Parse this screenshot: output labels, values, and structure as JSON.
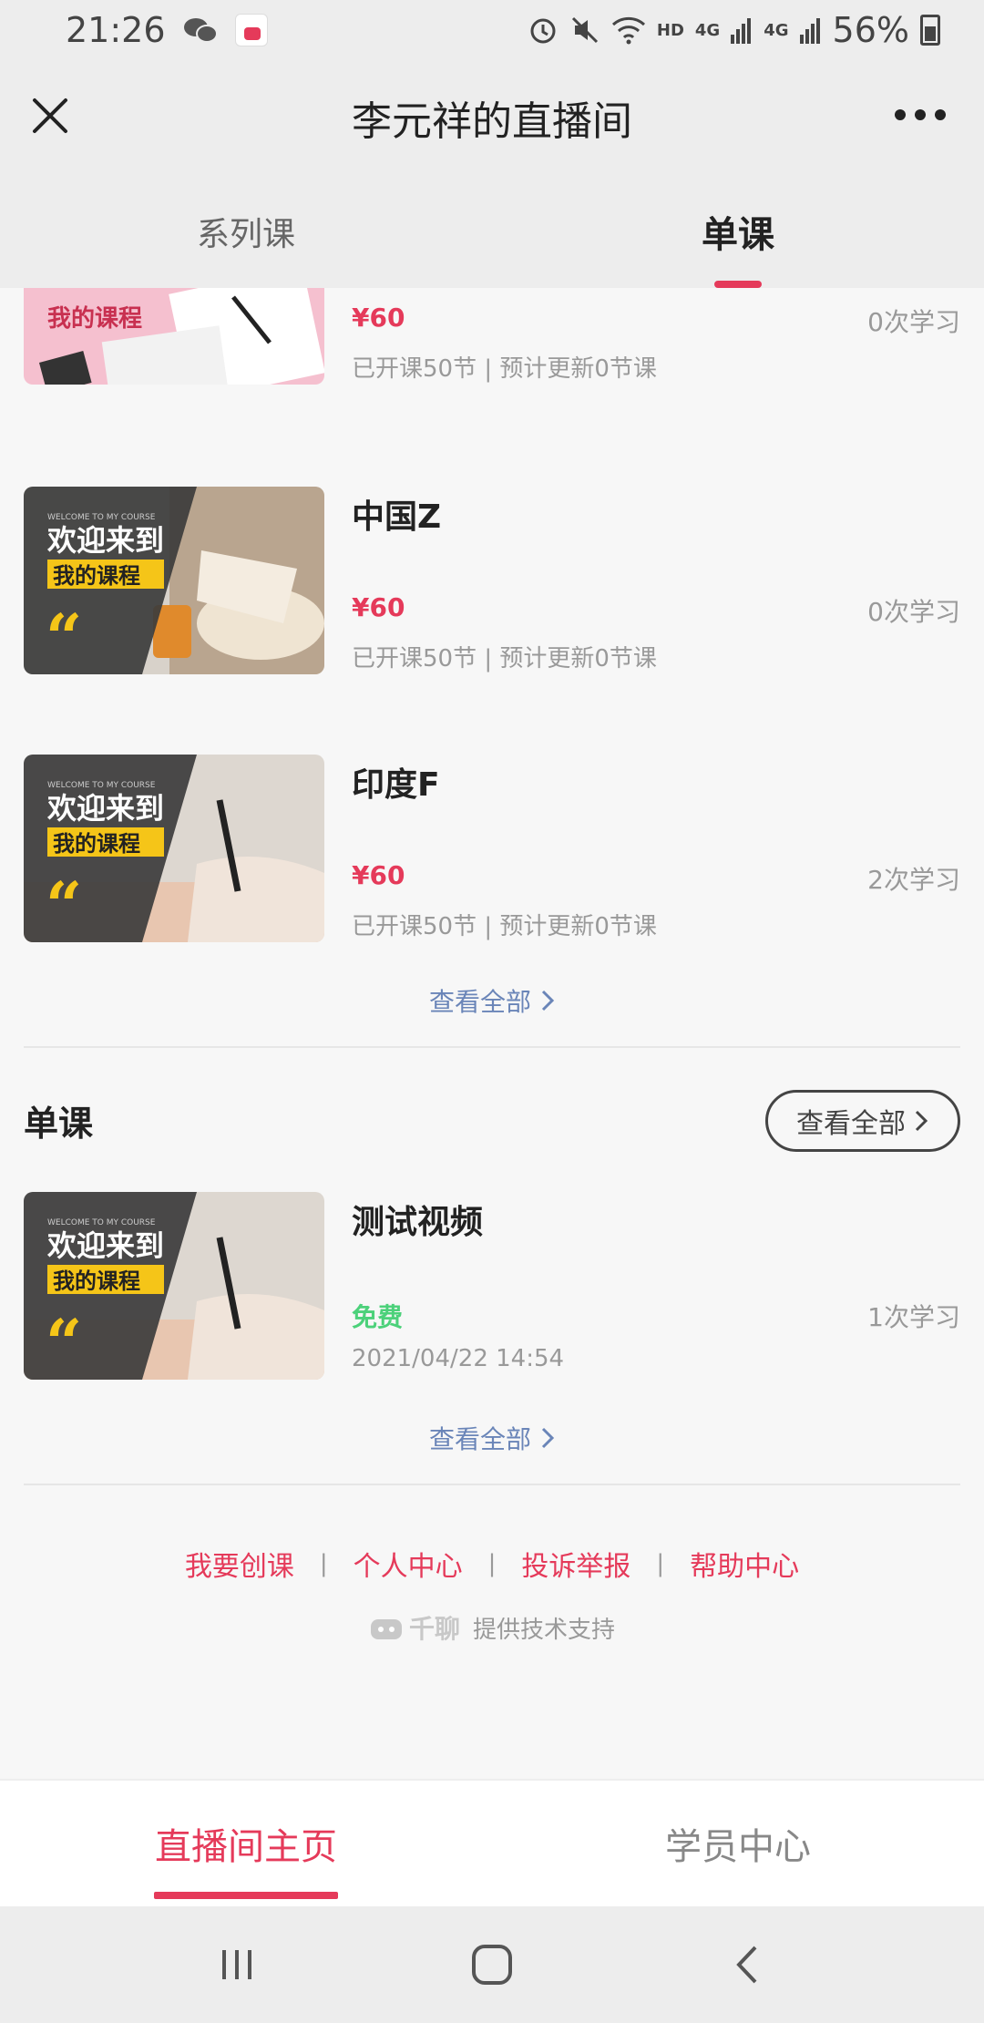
{
  "status_bar": {
    "time": "21:26",
    "icons": [
      "wechat-icon",
      "app-badge-icon",
      "alarm-icon",
      "mute-icon",
      "wifi-icon",
      "signal-icon",
      "battery-icon"
    ],
    "hd": "HD",
    "net1": "4G",
    "net2": "4G",
    "battery": "56%"
  },
  "header": {
    "title": "李元祥的直播间"
  },
  "tabs": [
    {
      "label": "系列课",
      "active": false
    },
    {
      "label": "单课",
      "active": true
    }
  ],
  "series_courses": [
    {
      "title": "",
      "price": "¥60",
      "count": "0次学习",
      "meta": "已开课50节 | 预计更新0节课",
      "thumb": "pink"
    },
    {
      "title": "中国Z",
      "price": "¥60",
      "count": "0次学习",
      "meta": "已开课50节 | 预计更新0节课",
      "thumb": "book"
    },
    {
      "title": "印度F",
      "price": "¥60",
      "count": "2次学习",
      "meta": "已开课50节 | 预计更新0节课",
      "thumb": "pen"
    }
  ],
  "view_all_1": "查看全部",
  "single_section": {
    "title": "单课",
    "button": "查看全部"
  },
  "single_courses": [
    {
      "title": "测试视频",
      "price": "免费",
      "count": "1次学习",
      "meta": "2021/04/22 14:54",
      "thumb": "pen"
    }
  ],
  "view_all_2": "查看全部",
  "thumb_text": {
    "welcome": "欢迎来到",
    "my_course": "我的课程",
    "small": "WELCOME TO MY COURSE"
  },
  "footer": {
    "links": [
      "我要创课",
      "个人中心",
      "投诉举报",
      "帮助中心"
    ],
    "brand": "千聊",
    "powered": "提供技术支持"
  },
  "bottom_nav": [
    {
      "label": "直播间主页",
      "active": true
    },
    {
      "label": "学员中心",
      "active": false
    }
  ],
  "colors": {
    "accent": "#e53a5a",
    "free": "#4cd17a",
    "link": "#6a85b8"
  }
}
